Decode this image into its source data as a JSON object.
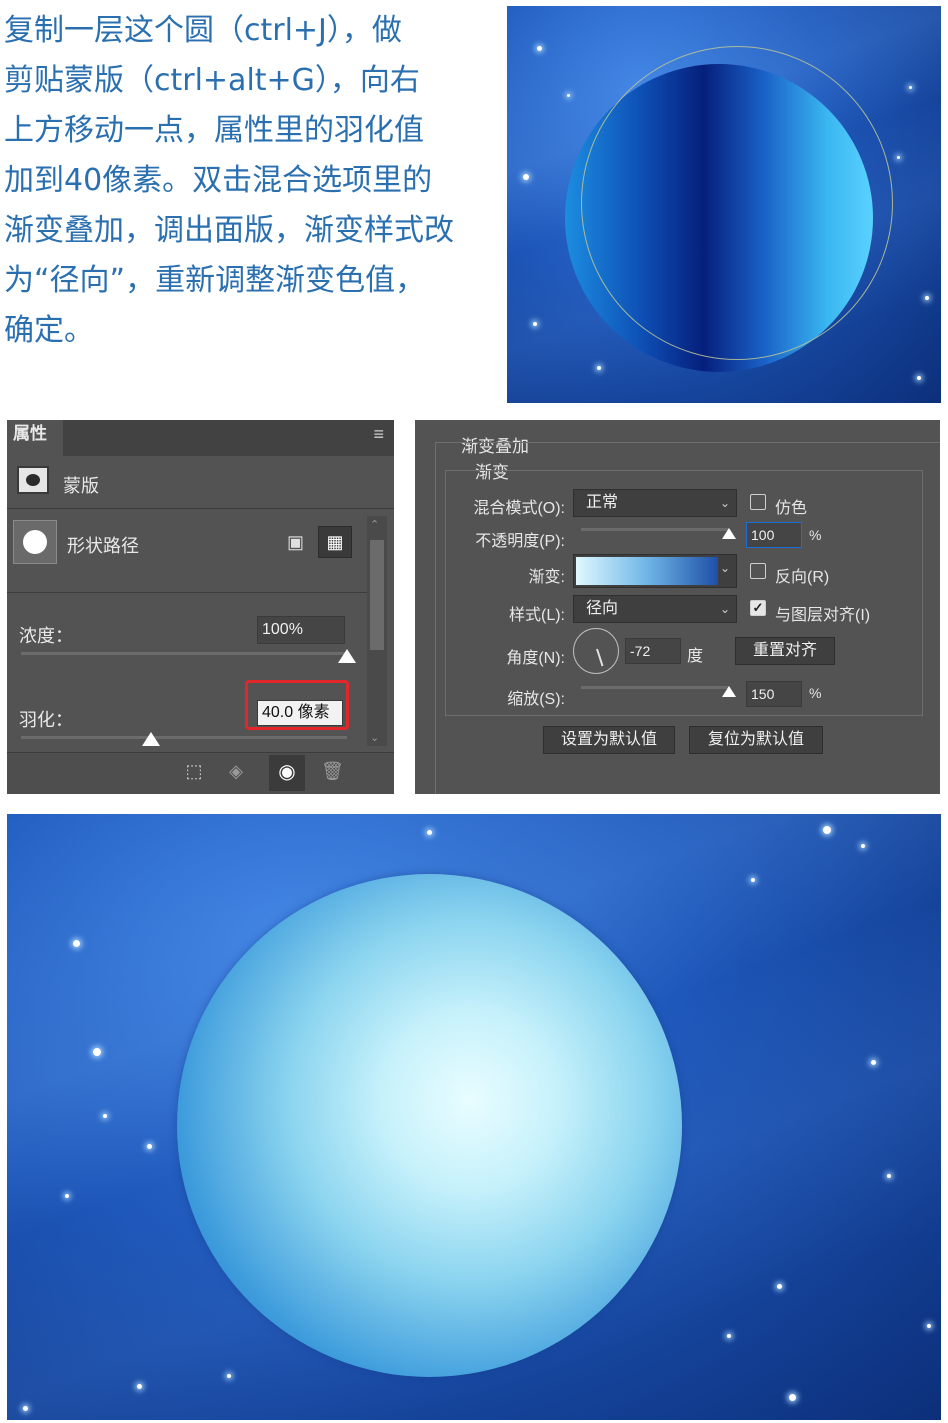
{
  "instructions": {
    "lines": [
      "复制一层这个圆（ctrl+J），做",
      "剪贴蒙版（ctrl+alt+G），向右",
      "上方移动一点，属性里的羽化值",
      "加到40像素。双击混合选项里的",
      "渐变叠加，调出面版，渐变样式改",
      "为“径向”，重新调整渐变色值，",
      "确定。"
    ]
  },
  "properties_panel": {
    "tab_title": "属性",
    "mask_label": "蒙版",
    "shape_path_label": "形状路径",
    "density_label": "浓度：",
    "density_value": "100%",
    "density_level": 1.0,
    "feather_label": "羽化：",
    "feather_value": "40.0 像素",
    "feather_level": 0.4,
    "highlight_color": "#e3262a",
    "icons": [
      "select-mask-icon",
      "apply-mask-icon",
      "visibility-eye-icon",
      "trash-icon",
      "add-mask-icon",
      "vector-mask-icon",
      "panel-menu-icon"
    ]
  },
  "gradient_dialog": {
    "title": "渐变叠加",
    "section": "渐变",
    "blend_mode_label": "混合模式(O):",
    "blend_mode_value": "正常",
    "dither_label": "仿色",
    "opacity_label": "不透明度(P):",
    "opacity_value": "100",
    "opacity_unit": "%",
    "gradient_label": "渐变:",
    "gradient_colors": [
      "#dff8ff",
      "#6fb6e6",
      "#1e4fa8"
    ],
    "reverse_label": "反向(R)",
    "style_label": "样式(L):",
    "style_value": "径向",
    "align_label": "与图层对齐(I)",
    "align_checked": true,
    "angle_label": "角度(N):",
    "angle_value": "-72",
    "angle_unit": "度",
    "reset_align_label": "重置对齐",
    "scale_label": "缩放(S):",
    "scale_value": "150",
    "scale_unit": "%",
    "set_default_label": "设置为默认值",
    "reset_default_label": "复位为默认值"
  }
}
